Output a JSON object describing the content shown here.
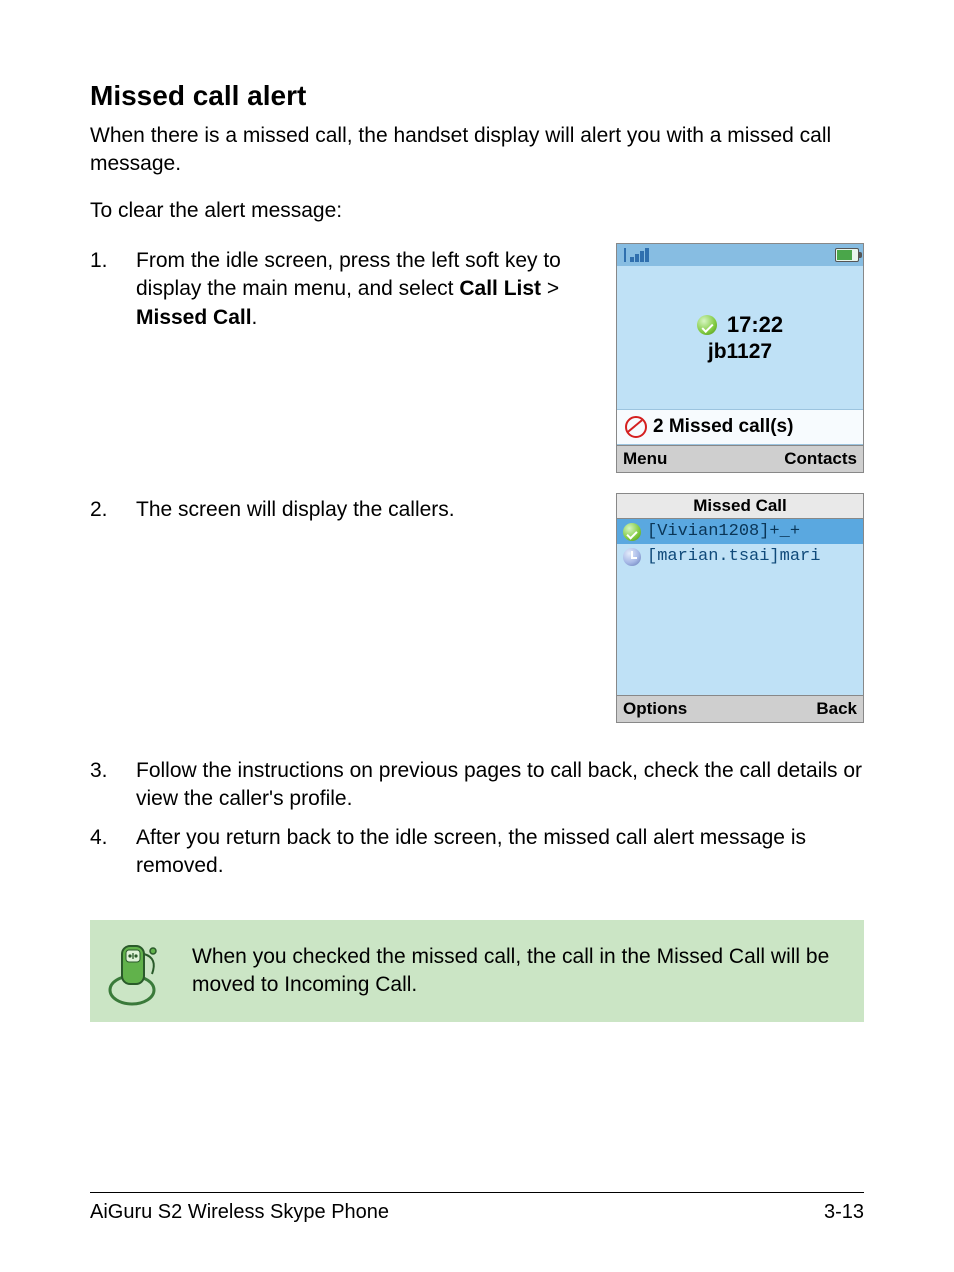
{
  "title": "Missed call alert",
  "intro": "When there is a missed call, the handset display will alert you with a missed call message.",
  "clear_msg": "To clear the alert message:",
  "steps": {
    "s1": {
      "num": "1.",
      "text_a": "From the idle screen, press the left soft key to display the main menu, and select ",
      "b1": "Call List",
      "gt": " > ",
      "b2": "Missed Call",
      "dot": "."
    },
    "s2": {
      "num": "2.",
      "text": "The screen will display the callers."
    },
    "s3": {
      "num": "3.",
      "text": "Follow the instructions on previous pages to call back, check the call details or view the caller's profile."
    },
    "s4": {
      "num": "4.",
      "text": "After you return back to the idle screen, the missed call alert message is removed."
    }
  },
  "phone1": {
    "time": "17:22",
    "user": "jb1127",
    "alert": "2 Missed call(s)",
    "left": "Menu",
    "right": "Contacts"
  },
  "phone2": {
    "title": "Missed Call",
    "caller1": "[Vivian1208]+_+",
    "caller2": "[marian.tsai]mari",
    "left": "Options",
    "right": "Back"
  },
  "note": "When you checked the missed call, the call in the Missed Call will be moved to Incoming Call.",
  "footer": {
    "left": "AiGuru S2 Wireless Skype Phone",
    "right": "3-13"
  }
}
